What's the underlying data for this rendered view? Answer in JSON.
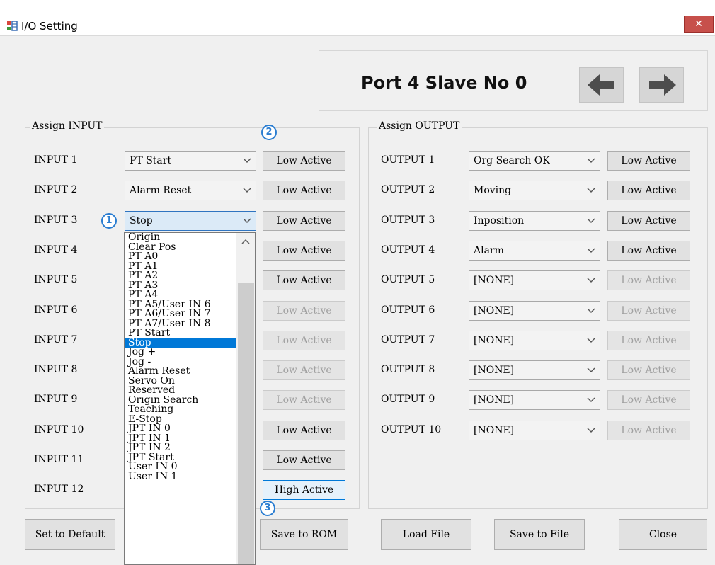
{
  "window": {
    "title": "I/O Setting",
    "close_label": "✕"
  },
  "header": {
    "port_title": "Port 4 Slave No 0",
    "prev_icon": "arrow-left-icon",
    "next_icon": "arrow-right-icon"
  },
  "input_group": {
    "label": "Assign INPUT",
    "rows": [
      {
        "label": "INPUT 1",
        "value": "PT Start",
        "button": "Low Active",
        "enabled": true
      },
      {
        "label": "INPUT 2",
        "value": "Alarm Reset",
        "button": "Low Active",
        "enabled": true
      },
      {
        "label": "INPUT 3",
        "value": "Stop",
        "button": "Low Active",
        "enabled": true
      },
      {
        "label": "INPUT 4",
        "value": "",
        "button": "Low Active",
        "enabled": true
      },
      {
        "label": "INPUT 5",
        "value": "",
        "button": "Low Active",
        "enabled": true
      },
      {
        "label": "INPUT 6",
        "value": "",
        "button": "Low Active",
        "enabled": false
      },
      {
        "label": "INPUT 7",
        "value": "",
        "button": "Low Active",
        "enabled": false
      },
      {
        "label": "INPUT 8",
        "value": "",
        "button": "Low Active",
        "enabled": false
      },
      {
        "label": "INPUT 9",
        "value": "",
        "button": "Low Active",
        "enabled": false
      },
      {
        "label": "INPUT 10",
        "value": "",
        "button": "Low Active",
        "enabled": true
      },
      {
        "label": "INPUT 11",
        "value": "",
        "button": "Low Active",
        "enabled": true
      },
      {
        "label": "INPUT 12",
        "value": "",
        "button": "High Active",
        "enabled": true
      }
    ]
  },
  "output_group": {
    "label": "Assign OUTPUT",
    "rows": [
      {
        "label": "OUTPUT 1",
        "value": "Org Search OK",
        "button": "Low Active",
        "enabled": true
      },
      {
        "label": "OUTPUT 2",
        "value": "Moving",
        "button": "Low Active",
        "enabled": true
      },
      {
        "label": "OUTPUT 3",
        "value": "Inposition",
        "button": "Low Active",
        "enabled": true
      },
      {
        "label": "OUTPUT 4",
        "value": "Alarm",
        "button": "Low Active",
        "enabled": true
      },
      {
        "label": "OUTPUT 5",
        "value": "[NONE]",
        "button": "Low Active",
        "enabled": false
      },
      {
        "label": "OUTPUT 6",
        "value": "[NONE]",
        "button": "Low Active",
        "enabled": false
      },
      {
        "label": "OUTPUT 7",
        "value": "[NONE]",
        "button": "Low Active",
        "enabled": false
      },
      {
        "label": "OUTPUT 8",
        "value": "[NONE]",
        "button": "Low Active",
        "enabled": false
      },
      {
        "label": "OUTPUT 9",
        "value": "[NONE]",
        "button": "Low Active",
        "enabled": false
      },
      {
        "label": "OUTPUT 10",
        "value": "[NONE]",
        "button": "Low Active",
        "enabled": false
      }
    ]
  },
  "dropdown": {
    "options": [
      "Origin",
      "Clear Pos",
      "PT A0",
      "PT A1",
      "PT A2",
      "PT A3",
      "PT A4",
      "PT A5/User IN 6",
      "PT A6/User IN 7",
      "PT A7/User IN 8",
      "PT Start",
      "Stop",
      "Jog +",
      "Jog -",
      "Alarm Reset",
      "Servo On",
      "Reserved",
      "Origin Search",
      "Teaching",
      "E-Stop",
      "JPT IN 0",
      "JPT IN 1",
      "JPT IN 2",
      "JPT Start",
      "User IN 0",
      "User IN 1"
    ],
    "selected": "Stop"
  },
  "markers": [
    "1",
    "2",
    "3"
  ],
  "footer": {
    "set_default": "Set to Default",
    "save_rom": "Save to ROM",
    "load_file": "Load File",
    "save_file": "Save to File",
    "close": "Close"
  },
  "colors": {
    "accent": "#0078d7",
    "marker": "#2a7dd1",
    "close_button": "#c7504b"
  }
}
